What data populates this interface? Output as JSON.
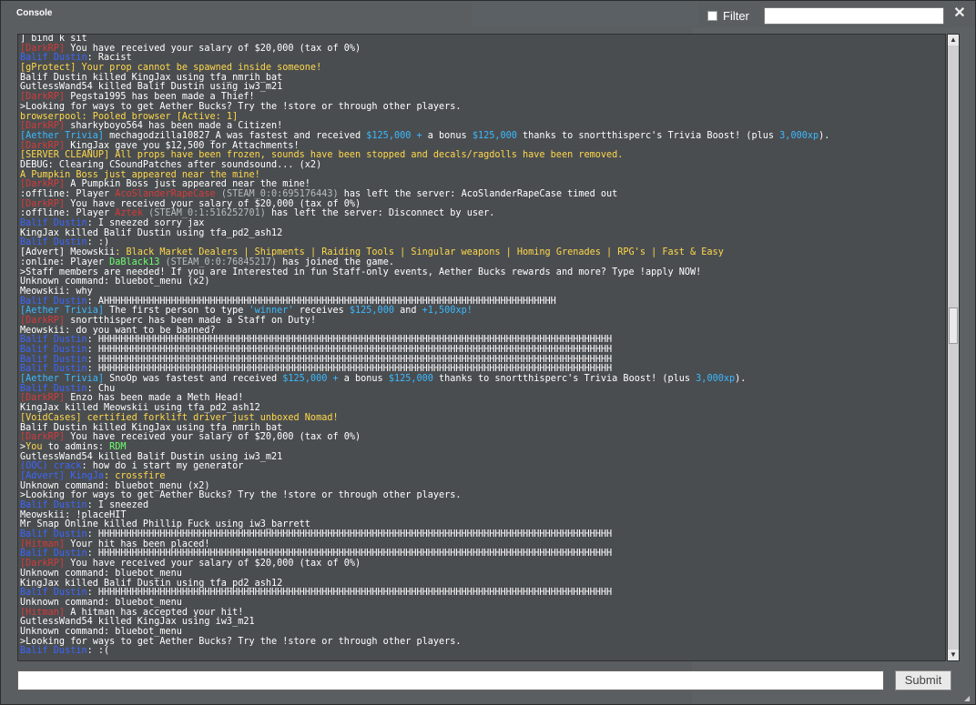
{
  "window": {
    "title": "Console",
    "filter_label": "Filter",
    "filter_value": "",
    "close_glyph": "✕",
    "submit_label": "Submit",
    "command_value": ""
  },
  "colors": {
    "red": "#d43b3b",
    "blue": "#3a66ff",
    "yellow": "#ffd84a",
    "green": "#6cff6c",
    "cyan": "#3ab9ff",
    "gray": "#b8bcc0",
    "white": "#ffffff"
  },
  "log": [
    [
      {
        "t": "] bind k sit",
        "c": "white"
      }
    ],
    [
      {
        "t": "[DarkRP] ",
        "c": "red"
      },
      {
        "t": "You have received your salary of $20,000 (tax of 0%)",
        "c": "white"
      }
    ],
    [
      {
        "t": "Balif Dustin",
        "c": "blue"
      },
      {
        "t": ": Racist",
        "c": "white"
      }
    ],
    [
      {
        "t": "[gProtect] Your prop cannot be spawned inside someone!",
        "c": "yellow"
      }
    ],
    [
      {
        "t": "Balif Dustin killed KingJax using tfa_nmrih_bat",
        "c": "white"
      }
    ],
    [
      {
        "t": "GutlessWand54 killed Balif Dustin using iw3_m21",
        "c": "white"
      }
    ],
    [
      {
        "t": "[DarkRP] ",
        "c": "red"
      },
      {
        "t": "Pegsta1995 has been made a Thief!",
        "c": "white"
      }
    ],
    [
      {
        "t": ">Looking for ways to get Aether Bucks? Try the !store or through other players.",
        "c": "white"
      }
    ],
    [
      {
        "t": "browserpool: Pooled browser [Active: 1]",
        "c": "yellow"
      }
    ],
    [
      {
        "t": "[DarkRP] ",
        "c": "red"
      },
      {
        "t": "sharkyboyo564 has been made a Citizen!",
        "c": "white"
      }
    ],
    [
      {
        "t": "[Aether Trivia] ",
        "c": "cyan"
      },
      {
        "t": "mechagodzilla10827_A was fastest and received ",
        "c": "white"
      },
      {
        "t": "$125,000 + ",
        "c": "cyan"
      },
      {
        "t": "a bonus ",
        "c": "white"
      },
      {
        "t": "$125,000 ",
        "c": "cyan"
      },
      {
        "t": "thanks to snortthisperc's Trivia Boost! (plus ",
        "c": "white"
      },
      {
        "t": "3,000xp",
        "c": "cyan"
      },
      {
        "t": ").",
        "c": "white"
      }
    ],
    [
      {
        "t": "[DarkRP] ",
        "c": "red"
      },
      {
        "t": "KingJax gave you $12,500 for Attachments!",
        "c": "white"
      }
    ],
    [
      {
        "t": "[SERVER CLEANUP] All props have been frozen, sounds have been stopped and decals/ragdolls have been removed.",
        "c": "yellow"
      }
    ],
    [
      {
        "t": "DEBUG: Clearing CSoundPatches after soundsound... (x2)",
        "c": "white"
      }
    ],
    [
      {
        "t": "A Pumpkin Boss just appeared near the mine!",
        "c": "yellow"
      }
    ],
    [
      {
        "t": "[DarkRP] ",
        "c": "red"
      },
      {
        "t": "A Pumpkin Boss just appeared near the mine!",
        "c": "white"
      }
    ],
    [
      {
        "t": ":offline: Player ",
        "c": "white"
      },
      {
        "t": "AcoSlanderRapeCase ",
        "c": "red"
      },
      {
        "t": "(STEAM_0:0:695176443) ",
        "c": "gray"
      },
      {
        "t": "has left the server: AcoSlanderRapeCase timed out",
        "c": "white"
      }
    ],
    [
      {
        "t": "[DarkRP] ",
        "c": "red"
      },
      {
        "t": "You have received your salary of $20,000 (tax of 0%)",
        "c": "white"
      }
    ],
    [
      {
        "t": ":offline: Player ",
        "c": "white"
      },
      {
        "t": "Aztek ",
        "c": "red"
      },
      {
        "t": "(STEAM_0:1:516252701) ",
        "c": "gray"
      },
      {
        "t": "has left the server: Disconnect by user.",
        "c": "white"
      }
    ],
    [
      {
        "t": "Balif Dustin",
        "c": "blue"
      },
      {
        "t": ": I sneezed sorry jax",
        "c": "white"
      }
    ],
    [
      {
        "t": "KingJax killed Balif Dustin using tfa_pd2_ash12",
        "c": "white"
      }
    ],
    [
      {
        "t": "Balif Dustin",
        "c": "blue"
      },
      {
        "t": ": :)",
        "c": "white"
      }
    ],
    [
      {
        "t": "[Advert] Meowskii",
        "c": "white"
      },
      {
        "t": ": Black Market Dealers | Shipments | Raiding Tools | Singular weapons | Homing Grenades | RPG's | Fast & Easy",
        "c": "yellow"
      }
    ],
    [
      {
        "t": ":online: Player ",
        "c": "white"
      },
      {
        "t": "DaBlack13 ",
        "c": "green"
      },
      {
        "t": "(STEAM_0:0:76845217) ",
        "c": "gray"
      },
      {
        "t": "has joined the game.",
        "c": "white"
      }
    ],
    [
      {
        "t": ">Staff members are needed! If you are Interested in fun Staff-only events, Aether Bucks rewards and more? Type !apply NOW!",
        "c": "white"
      }
    ],
    [
      {
        "t": "Unknown command: bluebot_menu (x2)",
        "c": "white"
      }
    ],
    [
      {
        "t": "Meowskii: why",
        "c": "white"
      }
    ],
    [
      {
        "t": "Balif Dustin",
        "c": "blue"
      },
      {
        "t": ": AHHHHHHHHHHHHHHHHHHHHHHHHHHHHHHHHHHHHHHHHHHHHHHHHHHHHHHHHHHHHHHHHHHHHHHHHHHHHHHHHH",
        "c": "white"
      }
    ],
    [
      {
        "t": "[Aether Trivia] ",
        "c": "cyan"
      },
      {
        "t": "The first person to type ",
        "c": "white"
      },
      {
        "t": "'winner' ",
        "c": "cyan"
      },
      {
        "t": "receives ",
        "c": "white"
      },
      {
        "t": "$125,000 ",
        "c": "cyan"
      },
      {
        "t": "and ",
        "c": "white"
      },
      {
        "t": "+1,500xp!",
        "c": "cyan"
      }
    ],
    [
      {
        "t": "[DarkRP] ",
        "c": "red"
      },
      {
        "t": "snortthisperc has been made a Staff on Duty!",
        "c": "white"
      }
    ],
    [
      {
        "t": "Meowskii: do you want to be banned?",
        "c": "white"
      }
    ],
    [
      {
        "t": "Balif Dustin",
        "c": "blue"
      },
      {
        "t": ": HHHHHHHHHHHHHHHHHHHHHHHHHHHHHHHHHHHHHHHHHHHHHHHHHHHHHHHHHHHHHHHHHHHHHHHHHHHHHHHHHHHHHHHHHHHH",
        "c": "white"
      }
    ],
    [
      {
        "t": "Balif Dustin",
        "c": "blue"
      },
      {
        "t": ": HHHHHHHHHHHHHHHHHHHHHHHHHHHHHHHHHHHHHHHHHHHHHHHHHHHHHHHHHHHHHHHHHHHHHHHHHHHHHHHHHHHHHHHHHHHH",
        "c": "white"
      }
    ],
    [
      {
        "t": "Balif Dustin",
        "c": "blue"
      },
      {
        "t": ": HHHHHHHHHHHHHHHHHHHHHHHHHHHHHHHHHHHHHHHHHHHHHHHHHHHHHHHHHHHHHHHHHHHHHHHHHHHHHHHHHHHHHHHHHHHH",
        "c": "white"
      }
    ],
    [
      {
        "t": "Balif Dustin",
        "c": "blue"
      },
      {
        "t": ": HHHHHHHHHHHHHHHHHHHHHHHHHHHHHHHHHHHHHHHHHHHHHHHHHHHHHHHHHHHHHHHHHHHHHHHHHHHHHHHHHHHHHHHHHHHH",
        "c": "white"
      }
    ],
    [
      {
        "t": "[Aether Trivia] ",
        "c": "cyan"
      },
      {
        "t": "SnoOp was fastest and received ",
        "c": "white"
      },
      {
        "t": "$125,000 + ",
        "c": "cyan"
      },
      {
        "t": "a bonus ",
        "c": "white"
      },
      {
        "t": "$125,000 ",
        "c": "cyan"
      },
      {
        "t": "thanks to snortthisperc's Trivia Boost! (plus ",
        "c": "white"
      },
      {
        "t": "3,000xp",
        "c": "cyan"
      },
      {
        "t": ").",
        "c": "white"
      }
    ],
    [
      {
        "t": "Balif Dustin",
        "c": "blue"
      },
      {
        "t": ": Chu",
        "c": "white"
      }
    ],
    [
      {
        "t": "[DarkRP] ",
        "c": "red"
      },
      {
        "t": "Enzo has been made a Meth Head!",
        "c": "white"
      }
    ],
    [
      {
        "t": "KingJax killed Meowskii using tfa_pd2_ash12",
        "c": "white"
      }
    ],
    [
      {
        "t": "[VoidCases] certified forklift driver just unboxed Nomad!",
        "c": "yellow"
      }
    ],
    [
      {
        "t": "Balif Dustin killed KingJax using tfa_nmrih_bat",
        "c": "white"
      }
    ],
    [
      {
        "t": "[DarkRP] ",
        "c": "red"
      },
      {
        "t": "You have received your salary of $20,000 (tax of 0%)",
        "c": "white"
      }
    ],
    [
      {
        "t": ">",
        "c": "white"
      },
      {
        "t": "You ",
        "c": "yellow"
      },
      {
        "t": "to admins: ",
        "c": "white"
      },
      {
        "t": "RDM",
        "c": "green"
      }
    ],
    [
      {
        "t": "GutlessWand54 killed Balif Dustin using iw3_m21",
        "c": "white"
      }
    ],
    [
      {
        "t": "(OOC) crack",
        "c": "blue"
      },
      {
        "t": ": how do i start my generator",
        "c": "white"
      }
    ],
    [
      {
        "t": "[Advert] KingJa",
        "c": "blue"
      },
      {
        "t": ": crossfire",
        "c": "yellow"
      }
    ],
    [
      {
        "t": "Unknown command: bluebot_menu (x2)",
        "c": "white"
      }
    ],
    [
      {
        "t": ">Looking for ways to get Aether Bucks? Try the !store or through other players.",
        "c": "white"
      }
    ],
    [
      {
        "t": "Balif Dustin",
        "c": "blue"
      },
      {
        "t": ": I sneezed",
        "c": "white"
      }
    ],
    [
      {
        "t": "Meowskii: !placeHIT",
        "c": "white"
      }
    ],
    [
      {
        "t": "Mr Snap Online killed Phillip Fuck using iw3_barrett",
        "c": "white"
      }
    ],
    [
      {
        "t": "Balif Dustin",
        "c": "blue"
      },
      {
        "t": ": HHHHHHHHHHHHHHHHHHHHHHHHHHHHHHHHHHHHHHHHHHHHHHHHHHHHHHHHHHHHHHHHHHHHHHHHHHHHHHHHHHHHHHHHHHHH",
        "c": "white"
      }
    ],
    [
      {
        "t": "[Hitman] ",
        "c": "red"
      },
      {
        "t": "Your hit has been placed!",
        "c": "white"
      }
    ],
    [
      {
        "t": "Balif Dustin",
        "c": "blue"
      },
      {
        "t": ": HHHHHHHHHHHHHHHHHHHHHHHHHHHHHHHHHHHHHHHHHHHHHHHHHHHHHHHHHHHHHHHHHHHHHHHHHHHHHHHHHHHHHHHHHHHH",
        "c": "white"
      }
    ],
    [
      {
        "t": "[DarkRP] ",
        "c": "red"
      },
      {
        "t": "You have received your salary of $20,000 (tax of 0%)",
        "c": "white"
      }
    ],
    [
      {
        "t": "Unknown command: bluebot_menu",
        "c": "white"
      }
    ],
    [
      {
        "t": "KingJax killed Balif Dustin using tfa_pd2_ash12",
        "c": "white"
      }
    ],
    [
      {
        "t": "Balif Dustin",
        "c": "blue"
      },
      {
        "t": ": HHHHHHHHHHHHHHHHHHHHHHHHHHHHHHHHHHHHHHHHHHHHHHHHHHHHHHHHHHHHHHHHHHHHHHHHHHHHHHHHHHHHHHHHHHHH",
        "c": "white"
      }
    ],
    [
      {
        "t": "Unknown command: bluebot_menu",
        "c": "white"
      }
    ],
    [
      {
        "t": "[Hitman] ",
        "c": "red"
      },
      {
        "t": "A hitman has accepted your hit!",
        "c": "white"
      }
    ],
    [
      {
        "t": "GutlessWand54 killed KingJax using iw3_m21",
        "c": "white"
      }
    ],
    [
      {
        "t": "Unknown command: bluebot_menu",
        "c": "white"
      }
    ],
    [
      {
        "t": ">Looking for ways to get Aether Bucks? Try the !store or through other players.",
        "c": "white"
      }
    ],
    [
      {
        "t": "Balif Dustin",
        "c": "blue"
      },
      {
        "t": ": :(",
        "c": "white"
      }
    ]
  ]
}
